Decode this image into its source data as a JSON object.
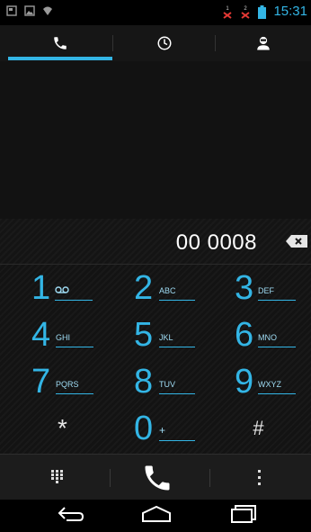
{
  "statusbar": {
    "time": "15:31"
  },
  "dialer": {
    "number": "00 0008"
  },
  "keys": [
    {
      "digit": "1",
      "letters": ""
    },
    {
      "digit": "2",
      "letters": "ABC"
    },
    {
      "digit": "3",
      "letters": "DEF"
    },
    {
      "digit": "4",
      "letters": "GHI"
    },
    {
      "digit": "5",
      "letters": "JKL"
    },
    {
      "digit": "6",
      "letters": "MNO"
    },
    {
      "digit": "7",
      "letters": "PQRS"
    },
    {
      "digit": "8",
      "letters": "TUV"
    },
    {
      "digit": "9",
      "letters": "WXYZ"
    },
    {
      "digit": "*",
      "letters": ""
    },
    {
      "digit": "0",
      "letters": "+"
    },
    {
      "digit": "#",
      "letters": ""
    }
  ],
  "icons": {
    "tabs": [
      "phone-icon",
      "clock-icon",
      "contacts-icon"
    ],
    "actions": [
      "dialpad-icon",
      "call-icon",
      "overflow-menu-icon"
    ],
    "nav": [
      "back-icon",
      "home-icon",
      "recents-icon"
    ]
  },
  "colors": {
    "accent": "#33b5e5",
    "missed": "#e53935"
  }
}
